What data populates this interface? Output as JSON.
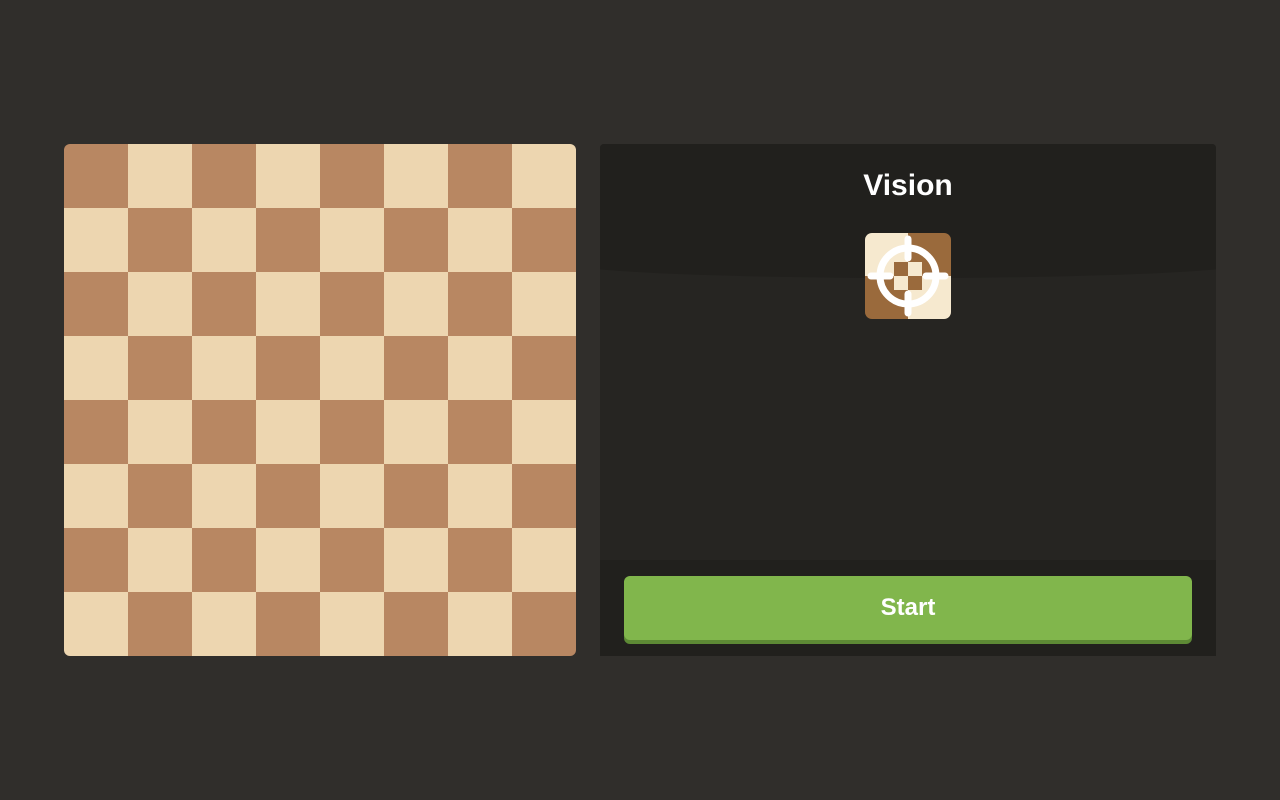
{
  "board": {
    "files": 8,
    "ranks": 8,
    "light_color": "#edd6b0",
    "dark_color": "#b88762"
  },
  "panel": {
    "title": "Vision",
    "icon": "crosshair-target-icon",
    "start_label": "Start"
  },
  "colors": {
    "background": "#302e2b",
    "panel": "#262522",
    "accent": "#81b64c"
  }
}
